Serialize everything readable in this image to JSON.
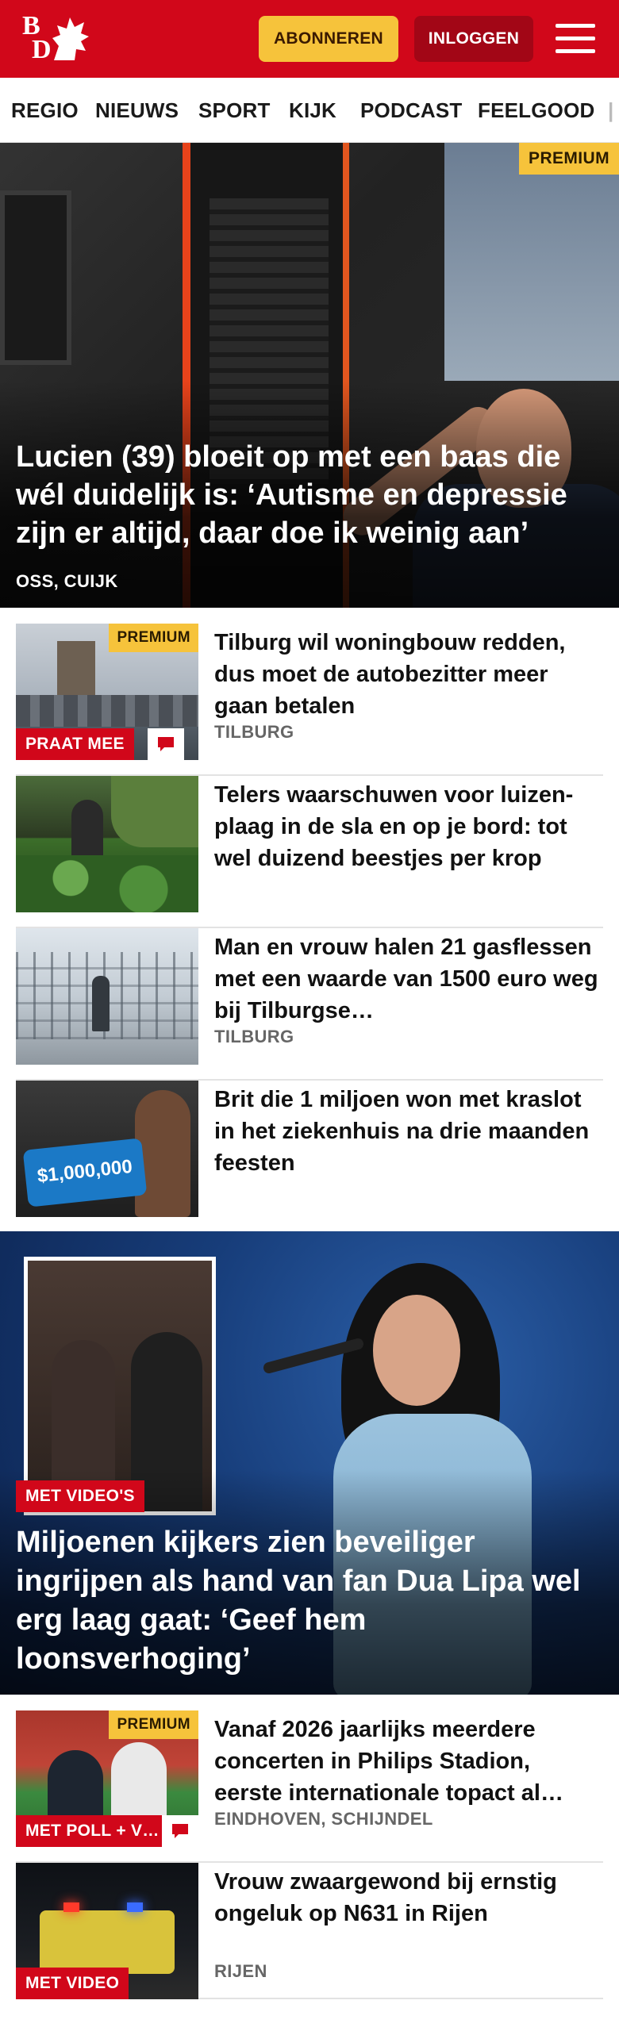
{
  "header": {
    "logo_top": "B",
    "logo_bottom": "D",
    "subscribe_label": "ABONNEREN",
    "login_label": "INLOGGEN",
    "colors": {
      "brand": "#d1071a",
      "subscribe": "#f6c33b",
      "login": "#a20616"
    }
  },
  "nav": {
    "items": [
      "REGIO",
      "NIEUWS",
      "SPORT",
      "KIJK",
      "PODCAST",
      "FEELGOOD"
    ]
  },
  "hero": {
    "badge": "PREMIUM",
    "title": "Lucien (39) bloeit op met een baas die wél duidelijk is: ‘Autisme en depressie zijn er altijd, daar doe ik weinig aan’",
    "tag": "OSS, CUIJK"
  },
  "articles": [
    {
      "title": "Tilburg wil woningbouw redden, dus moet de autobezitter meer gaan betalen",
      "tag": "TILBURG",
      "badge": "PREMIUM",
      "label": "PRAAT MEE"
    },
    {
      "title": "Telers waarschuwen voor luizen­plaag in de sla en op je bord: tot wel duizend beestjes per krop"
    },
    {
      "title": "Man en vrouw halen 21 gasflessen met een waarde van 1500 euro weg bij Tilburgse…",
      "tag": "TILBURG"
    },
    {
      "title": "Brit die 1 miljoen won met kraslot in het ziekenhuis na drie maanden feesten",
      "thumb_text": "$1,000,000"
    }
  ],
  "video_hero": {
    "label": "MET VIDEO'S",
    "title": "Miljoenen kijkers zien beveiliger ingrijpen als hand van fan Dua Lipa wel erg laag gaat: ‘Geef hem loonsverhoging’"
  },
  "articles2": [
    {
      "title": "Vanaf 2026 jaarlijks meerdere concerten in Philips Stadion, eerste internationale topact al…",
      "tag": "EINDHOVEN, SCHIJNDEL",
      "badge": "PREMIUM",
      "label": "MET POLL + V…"
    },
    {
      "title": "Vrouw zwaargewond bij ernstig ongeluk op N631 in Rijen",
      "tag": "RIJEN",
      "label": "MET VIDEO"
    }
  ]
}
